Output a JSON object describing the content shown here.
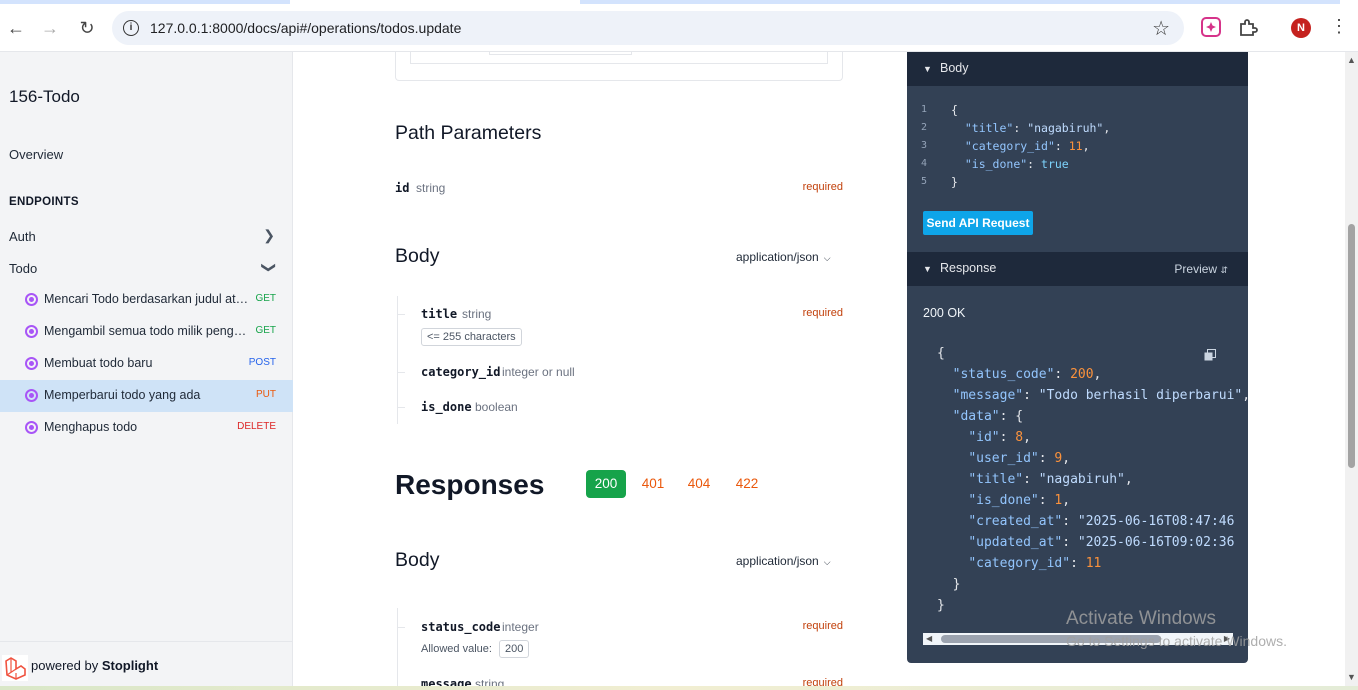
{
  "browser": {
    "url": "127.0.0.1:8000/docs/api#/operations/todos.update",
    "profile_initial": "N"
  },
  "sidebar": {
    "title": "156-Todo",
    "overview": "Overview",
    "section_label": "ENDPOINTS",
    "groups": [
      {
        "label": "Auth",
        "expanded": false
      },
      {
        "label": "Todo",
        "expanded": true
      }
    ],
    "items": [
      {
        "name": "Mencari Todo berdasarkan judul atau kategori",
        "method": "GET",
        "method_color": "#16a34a",
        "active": false
      },
      {
        "name": "Mengambil semua todo milik pengguna",
        "method": "GET",
        "method_color": "#16a34a",
        "active": false
      },
      {
        "name": "Membuat todo baru",
        "method": "POST",
        "method_color": "#2563eb",
        "active": false
      },
      {
        "name": "Memperbarui todo yang ada",
        "method": "PUT",
        "method_color": "#ea580c",
        "active": true
      },
      {
        "name": "Menghapus todo",
        "method": "DELETE",
        "method_color": "#dc2626",
        "active": false
      }
    ],
    "footer_prefix": "powered by ",
    "footer_brand": "Stoplight"
  },
  "main": {
    "path_params_title": "Path Parameters",
    "path_param": {
      "name": "id",
      "type": "string",
      "required": "required"
    },
    "body_title": "Body",
    "content_type": "application/json",
    "body_fields": [
      {
        "name": "title",
        "type": "string",
        "required": "required",
        "constraint": "<= 255 characters"
      },
      {
        "name": "category_id",
        "type": "integer or null",
        "required": ""
      },
      {
        "name": "is_done",
        "type": "boolean",
        "required": ""
      }
    ],
    "responses_title": "Responses",
    "response_codes": [
      "200",
      "401",
      "404",
      "422"
    ],
    "active_response": "200",
    "response_body_title": "Body",
    "response_content_type": "application/json",
    "response_fields": [
      {
        "name": "status_code",
        "type": "integer",
        "required": "required",
        "allowed_label": "Allowed value:",
        "allowed_value": "200"
      },
      {
        "name": "message",
        "type": "string",
        "required": "required"
      }
    ]
  },
  "right_panel": {
    "body_header": "Body",
    "request_body_lines": [
      {
        "n": "1",
        "text": "{"
      },
      {
        "n": "2",
        "key": "\"title\"",
        "value": "\"nagabiruh\"",
        "vtype": "s",
        "trail": ","
      },
      {
        "n": "3",
        "key": "\"category_id\"",
        "value": "11",
        "vtype": "n",
        "trail": ","
      },
      {
        "n": "4",
        "key": "\"is_done\"",
        "value": "true",
        "vtype": "b",
        "trail": ""
      },
      {
        "n": "5",
        "text": "}"
      }
    ],
    "send_button": "Send API Request",
    "response_header": "Response",
    "preview_label": "Preview",
    "status": "200 OK",
    "response_lines": [
      {
        "indent": 0,
        "text": "{"
      },
      {
        "indent": 1,
        "key": "\"status_code\"",
        "value": "200",
        "vtype": "n",
        "trail": ","
      },
      {
        "indent": 1,
        "key": "\"message\"",
        "value": "\"Todo berhasil diperbarui\"",
        "vtype": "s",
        "trail": ","
      },
      {
        "indent": 1,
        "key": "\"data\"",
        "value": "{",
        "vtype": "p",
        "trail": ""
      },
      {
        "indent": 2,
        "key": "\"id\"",
        "value": "8",
        "vtype": "n",
        "trail": ","
      },
      {
        "indent": 2,
        "key": "\"user_id\"",
        "value": "9",
        "vtype": "n",
        "trail": ","
      },
      {
        "indent": 2,
        "key": "\"title\"",
        "value": "\"nagabiruh\"",
        "vtype": "s",
        "trail": ","
      },
      {
        "indent": 2,
        "key": "\"is_done\"",
        "value": "1",
        "vtype": "n",
        "trail": ","
      },
      {
        "indent": 2,
        "key": "\"created_at\"",
        "value": "\"2025-06-16T08:47:46",
        "vtype": "s",
        "trail": ""
      },
      {
        "indent": 2,
        "key": "\"updated_at\"",
        "value": "\"2025-06-16T09:02:36",
        "vtype": "s",
        "trail": ""
      },
      {
        "indent": 2,
        "key": "\"category_id\"",
        "value": "11",
        "vtype": "n",
        "trail": ""
      },
      {
        "indent": 1,
        "text": "}"
      },
      {
        "indent": 0,
        "text": "}"
      }
    ]
  },
  "watermark": {
    "line1": "Activate Windows",
    "line2": "Go to Settings to activate Windows."
  }
}
